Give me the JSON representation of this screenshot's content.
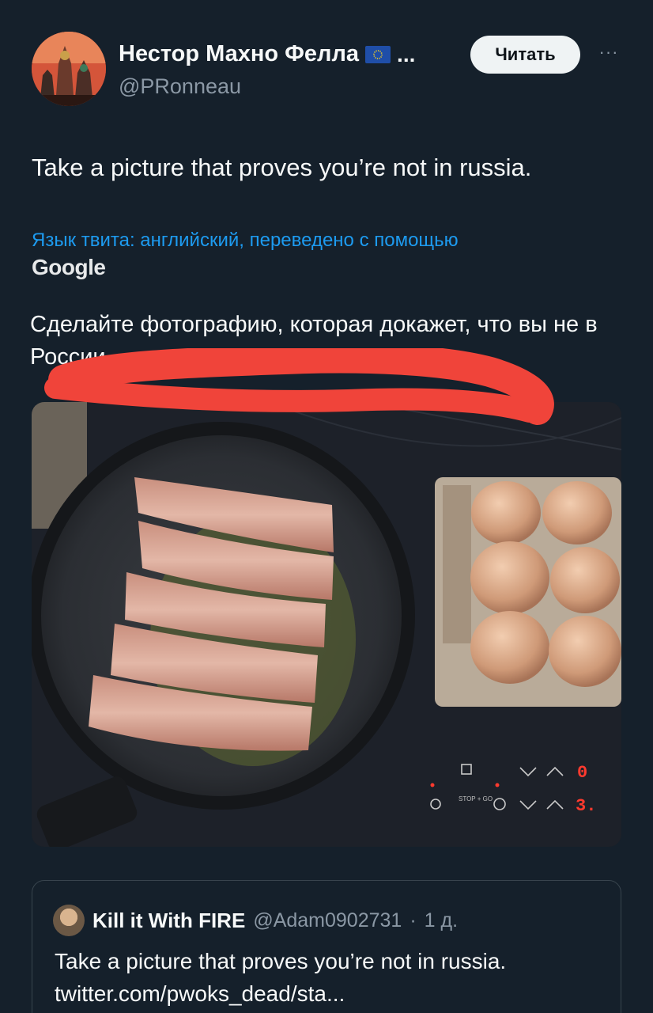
{
  "author": {
    "display_name": "Нестор Махно Фелла",
    "flag_icon": "eu-flag-icon",
    "truncation": "...",
    "handle": "@PRonneau"
  },
  "actions": {
    "follow_label": "Читать",
    "more_label": "···"
  },
  "tweet": {
    "text": "Take a picture that proves you’re not in russia.",
    "translation_note": "Язык твита: английский, переведено с помощью",
    "translation_provider": "Google",
    "translated_text": "Сделайте фотографию, которая докажет, что вы не в России."
  },
  "photo": {
    "stove_display": {
      "top_value": "0",
      "bottom_value": "3.",
      "stop_go_label": "STOP + GO"
    }
  },
  "quoted_tweet": {
    "display_name": "Kill it With FIRE",
    "handle": "@Adam0902731",
    "separator": "·",
    "time": "1 д.",
    "text": "Take a picture that proves you’re not in russia.",
    "link": "twitter.com/pwoks_dead/sta..."
  },
  "colors": {
    "background": "#15202b",
    "link_blue": "#1d9bf0",
    "secondary_text": "#8b98a5",
    "scribble_red": "#f0443a"
  }
}
